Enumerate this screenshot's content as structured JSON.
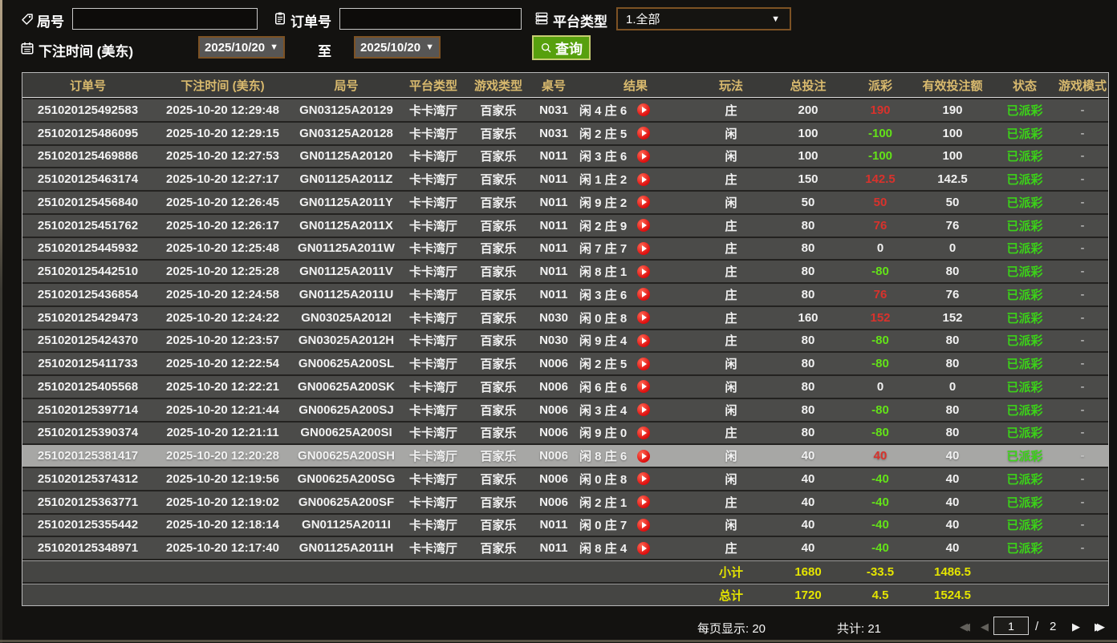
{
  "filters": {
    "round_label": "局号",
    "order_label": "订单号",
    "platform_label": "平台类型",
    "platform_value": "1.全部",
    "bet_time_label": "下注时间 (美东)",
    "date_from": "2025/10/20",
    "date_to": "2025/10/20",
    "to_label": "至",
    "query_label": "查询",
    "round_input_value": "",
    "order_input_value": ""
  },
  "icons": {
    "round": "tag-icon",
    "order": "clipboard-icon",
    "platform": "server-icon",
    "bet_time": "calendar-icon",
    "query": "search-icon",
    "result": "play-icon"
  },
  "colors": {
    "header_gold": "#d9ba6e",
    "win_red": "#d9322c",
    "loss_green": "#63e218",
    "status_green": "#3bd318",
    "summary_yellow": "#e5e500",
    "button_green": "#57a00e",
    "row_gray": "#4b4b49",
    "selected_row": "#a7a7a5"
  },
  "table": {
    "headers": [
      "订单号",
      "下注时间 (美东)",
      "局号",
      "平台类型",
      "游戏类型",
      "桌号",
      "结果",
      "玩法",
      "总投注",
      "派彩",
      "有效投注额",
      "状态",
      "游戏模式"
    ],
    "rows": [
      {
        "order": "251020125492583",
        "time": "2025-10-20 12:29:48",
        "round": "GN03125A20129",
        "platform": "卡卡湾厅",
        "game": "百家乐",
        "table": "N031",
        "result": "闲 4 庄 6",
        "play": "庄",
        "total": "200",
        "payout": "190",
        "payout_type": "win",
        "valid": "190",
        "status": "已派彩",
        "mode": "-",
        "selected": false
      },
      {
        "order": "251020125486095",
        "time": "2025-10-20 12:29:15",
        "round": "GN03125A20128",
        "platform": "卡卡湾厅",
        "game": "百家乐",
        "table": "N031",
        "result": "闲 2 庄 5",
        "play": "闲",
        "total": "100",
        "payout": "-100",
        "payout_type": "loss",
        "valid": "100",
        "status": "已派彩",
        "mode": "-",
        "selected": false
      },
      {
        "order": "251020125469886",
        "time": "2025-10-20 12:27:53",
        "round": "GN01125A20120",
        "platform": "卡卡湾厅",
        "game": "百家乐",
        "table": "N011",
        "result": "闲 3 庄 6",
        "play": "闲",
        "total": "100",
        "payout": "-100",
        "payout_type": "loss",
        "valid": "100",
        "status": "已派彩",
        "mode": "-",
        "selected": false
      },
      {
        "order": "251020125463174",
        "time": "2025-10-20 12:27:17",
        "round": "GN01125A2011Z",
        "platform": "卡卡湾厅",
        "game": "百家乐",
        "table": "N011",
        "result": "闲 1 庄 2",
        "play": "庄",
        "total": "150",
        "payout": "142.5",
        "payout_type": "win",
        "valid": "142.5",
        "status": "已派彩",
        "mode": "-",
        "selected": false
      },
      {
        "order": "251020125456840",
        "time": "2025-10-20 12:26:45",
        "round": "GN01125A2011Y",
        "platform": "卡卡湾厅",
        "game": "百家乐",
        "table": "N011",
        "result": "闲 9 庄 2",
        "play": "闲",
        "total": "50",
        "payout": "50",
        "payout_type": "win",
        "valid": "50",
        "status": "已派彩",
        "mode": "-",
        "selected": false
      },
      {
        "order": "251020125451762",
        "time": "2025-10-20 12:26:17",
        "round": "GN01125A2011X",
        "platform": "卡卡湾厅",
        "game": "百家乐",
        "table": "N011",
        "result": "闲 2 庄 9",
        "play": "庄",
        "total": "80",
        "payout": "76",
        "payout_type": "win",
        "valid": "76",
        "status": "已派彩",
        "mode": "-",
        "selected": false
      },
      {
        "order": "251020125445932",
        "time": "2025-10-20 12:25:48",
        "round": "GN01125A2011W",
        "platform": "卡卡湾厅",
        "game": "百家乐",
        "table": "N011",
        "result": "闲 7 庄 7",
        "play": "庄",
        "total": "80",
        "payout": "0",
        "payout_type": "zero",
        "valid": "0",
        "status": "已派彩",
        "mode": "-",
        "selected": false
      },
      {
        "order": "251020125442510",
        "time": "2025-10-20 12:25:28",
        "round": "GN01125A2011V",
        "platform": "卡卡湾厅",
        "game": "百家乐",
        "table": "N011",
        "result": "闲 8 庄 1",
        "play": "庄",
        "total": "80",
        "payout": "-80",
        "payout_type": "loss",
        "valid": "80",
        "status": "已派彩",
        "mode": "-",
        "selected": false
      },
      {
        "order": "251020125436854",
        "time": "2025-10-20 12:24:58",
        "round": "GN01125A2011U",
        "platform": "卡卡湾厅",
        "game": "百家乐",
        "table": "N011",
        "result": "闲 3 庄 6",
        "play": "庄",
        "total": "80",
        "payout": "76",
        "payout_type": "win",
        "valid": "76",
        "status": "已派彩",
        "mode": "-",
        "selected": false
      },
      {
        "order": "251020125429473",
        "time": "2025-10-20 12:24:22",
        "round": "GN03025A2012I",
        "platform": "卡卡湾厅",
        "game": "百家乐",
        "table": "N030",
        "result": "闲 0 庄 8",
        "play": "庄",
        "total": "160",
        "payout": "152",
        "payout_type": "win",
        "valid": "152",
        "status": "已派彩",
        "mode": "-",
        "selected": false
      },
      {
        "order": "251020125424370",
        "time": "2025-10-20 12:23:57",
        "round": "GN03025A2012H",
        "platform": "卡卡湾厅",
        "game": "百家乐",
        "table": "N030",
        "result": "闲 9 庄 4",
        "play": "庄",
        "total": "80",
        "payout": "-80",
        "payout_type": "loss",
        "valid": "80",
        "status": "已派彩",
        "mode": "-",
        "selected": false
      },
      {
        "order": "251020125411733",
        "time": "2025-10-20 12:22:54",
        "round": "GN00625A200SL",
        "platform": "卡卡湾厅",
        "game": "百家乐",
        "table": "N006",
        "result": "闲 2 庄 5",
        "play": "闲",
        "total": "80",
        "payout": "-80",
        "payout_type": "loss",
        "valid": "80",
        "status": "已派彩",
        "mode": "-",
        "selected": false
      },
      {
        "order": "251020125405568",
        "time": "2025-10-20 12:22:21",
        "round": "GN00625A200SK",
        "platform": "卡卡湾厅",
        "game": "百家乐",
        "table": "N006",
        "result": "闲 6 庄 6",
        "play": "闲",
        "total": "80",
        "payout": "0",
        "payout_type": "zero",
        "valid": "0",
        "status": "已派彩",
        "mode": "-",
        "selected": false
      },
      {
        "order": "251020125397714",
        "time": "2025-10-20 12:21:44",
        "round": "GN00625A200SJ",
        "platform": "卡卡湾厅",
        "game": "百家乐",
        "table": "N006",
        "result": "闲 3 庄 4",
        "play": "闲",
        "total": "80",
        "payout": "-80",
        "payout_type": "loss",
        "valid": "80",
        "status": "已派彩",
        "mode": "-",
        "selected": false
      },
      {
        "order": "251020125390374",
        "time": "2025-10-20 12:21:11",
        "round": "GN00625A200SI",
        "platform": "卡卡湾厅",
        "game": "百家乐",
        "table": "N006",
        "result": "闲 9 庄 0",
        "play": "庄",
        "total": "80",
        "payout": "-80",
        "payout_type": "loss",
        "valid": "80",
        "status": "已派彩",
        "mode": "-",
        "selected": false
      },
      {
        "order": "251020125381417",
        "time": "2025-10-20 12:20:28",
        "round": "GN00625A200SH",
        "platform": "卡卡湾厅",
        "game": "百家乐",
        "table": "N006",
        "result": "闲 8 庄 6",
        "play": "闲",
        "total": "40",
        "payout": "40",
        "payout_type": "win",
        "valid": "40",
        "status": "已派彩",
        "mode": "-",
        "selected": true
      },
      {
        "order": "251020125374312",
        "time": "2025-10-20 12:19:56",
        "round": "GN00625A200SG",
        "platform": "卡卡湾厅",
        "game": "百家乐",
        "table": "N006",
        "result": "闲 0 庄 8",
        "play": "闲",
        "total": "40",
        "payout": "-40",
        "payout_type": "loss",
        "valid": "40",
        "status": "已派彩",
        "mode": "-",
        "selected": false
      },
      {
        "order": "251020125363771",
        "time": "2025-10-20 12:19:02",
        "round": "GN00625A200SF",
        "platform": "卡卡湾厅",
        "game": "百家乐",
        "table": "N006",
        "result": "闲 2 庄 1",
        "play": "庄",
        "total": "40",
        "payout": "-40",
        "payout_type": "loss",
        "valid": "40",
        "status": "已派彩",
        "mode": "-",
        "selected": false
      },
      {
        "order": "251020125355442",
        "time": "2025-10-20 12:18:14",
        "round": "GN01125A2011I",
        "platform": "卡卡湾厅",
        "game": "百家乐",
        "table": "N011",
        "result": "闲 0 庄 7",
        "play": "闲",
        "total": "40",
        "payout": "-40",
        "payout_type": "loss",
        "valid": "40",
        "status": "已派彩",
        "mode": "-",
        "selected": false
      },
      {
        "order": "251020125348971",
        "time": "2025-10-20 12:17:40",
        "round": "GN01125A2011H",
        "platform": "卡卡湾厅",
        "game": "百家乐",
        "table": "N011",
        "result": "闲 8 庄 4",
        "play": "庄",
        "total": "40",
        "payout": "-40",
        "payout_type": "loss",
        "valid": "40",
        "status": "已派彩",
        "mode": "-",
        "selected": false
      }
    ],
    "subtotal": {
      "label": "小计",
      "total": "1680",
      "payout": "-33.5",
      "valid": "1486.5"
    },
    "grand_total": {
      "label": "总计",
      "total": "1720",
      "payout": "4.5",
      "valid": "1524.5"
    }
  },
  "footer": {
    "per_page_text": "每页显示: 20",
    "total_text": "共计: 21",
    "page_value": "1",
    "page_separator": "/",
    "page_total": "2"
  }
}
